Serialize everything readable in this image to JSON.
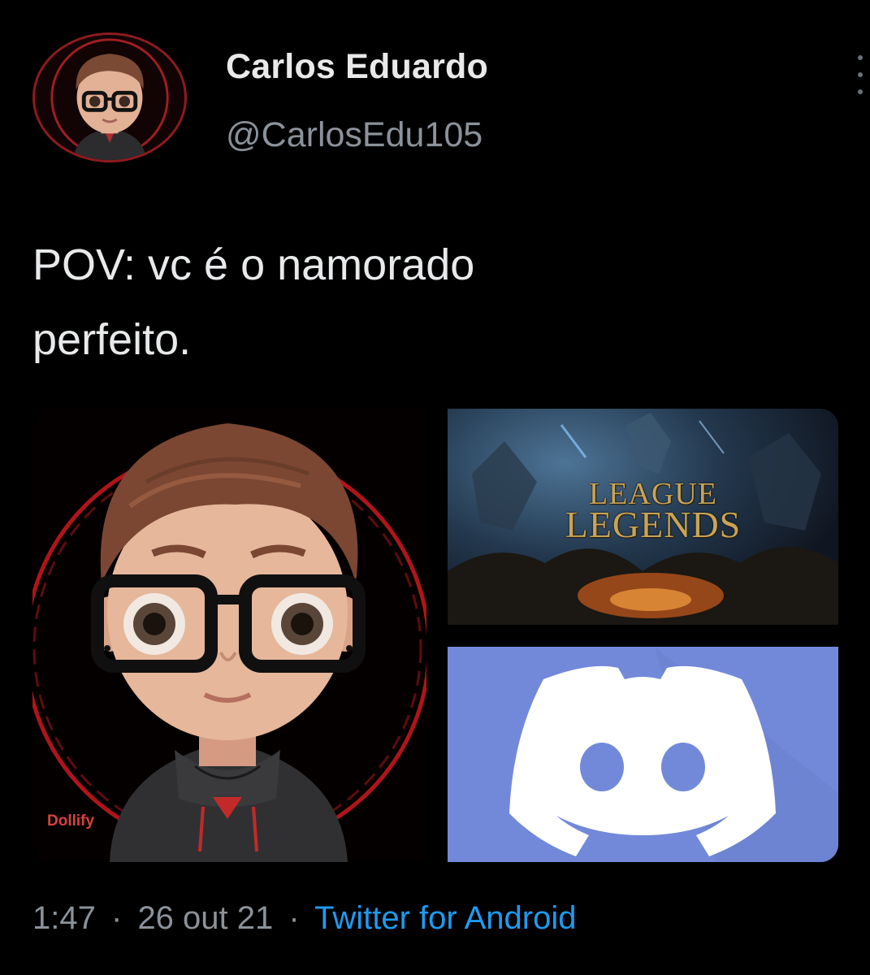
{
  "user": {
    "display_name": "Carlos Eduardo",
    "handle": "@CarlosEdu105"
  },
  "tweet": {
    "text_line1": "POV: vc é o namorado",
    "text_line2": "perfeito."
  },
  "media": {
    "left_watermark": "Dollify",
    "game_logo_line1": "LEAGUE",
    "game_logo_line2": "LEGENDS"
  },
  "meta": {
    "time": "1:47",
    "separator": "·",
    "date": "26 out 21",
    "source": "Twitter for Android"
  },
  "colors": {
    "background": "#000000",
    "link": "#1d9bf0",
    "discord": "#7289da",
    "avatar_ring": "#8e1b1f"
  }
}
